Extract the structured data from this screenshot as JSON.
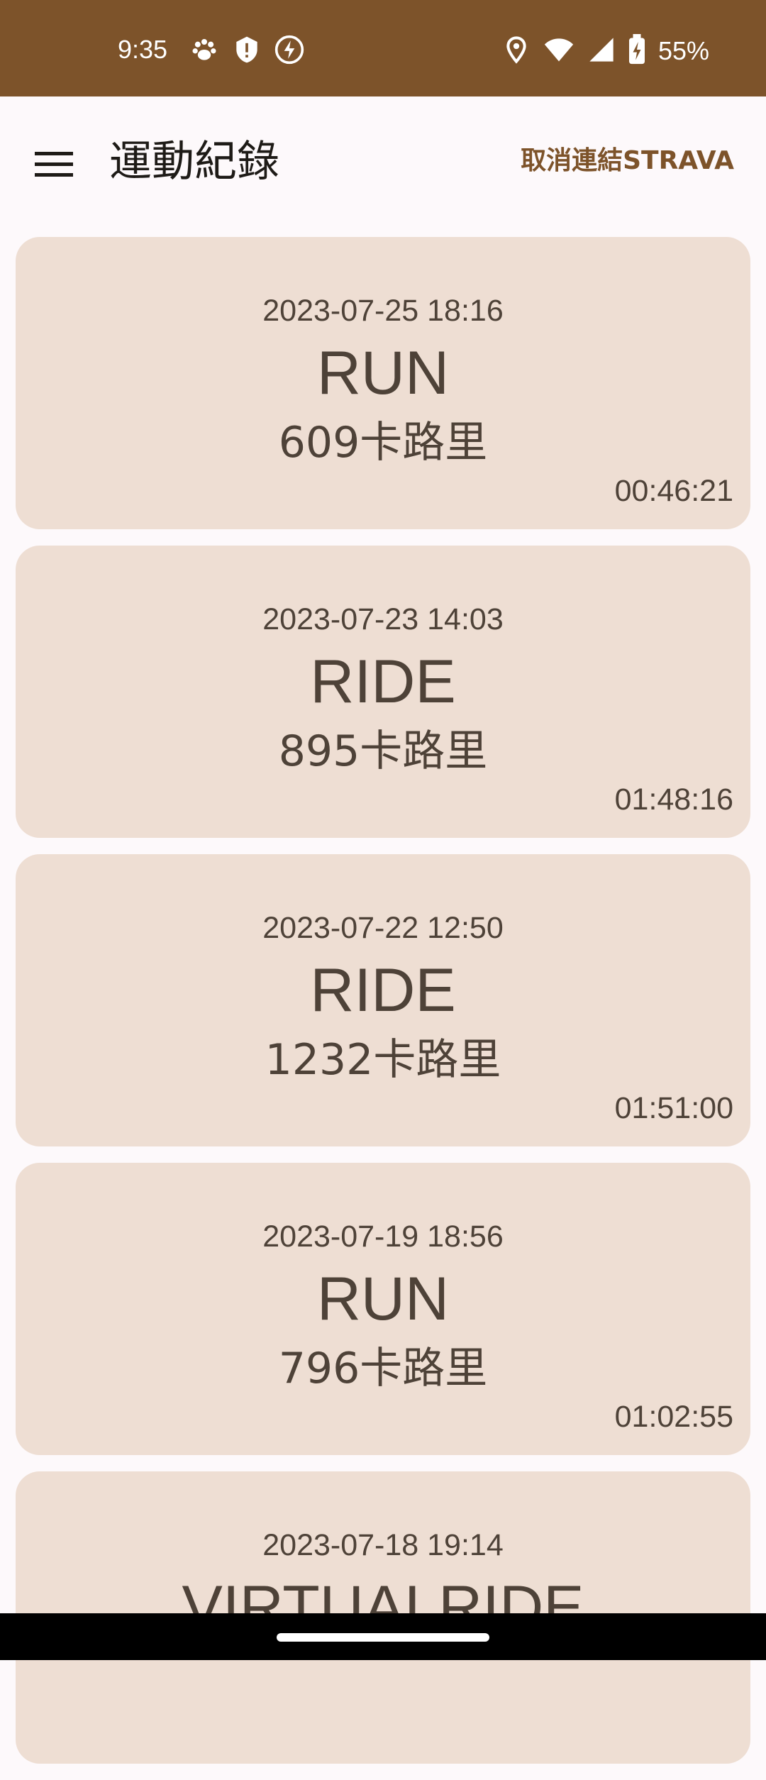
{
  "status_bar": {
    "time": "9:35",
    "left_icons": [
      "paw-icon",
      "shield-icon",
      "bolt-icon"
    ],
    "right_icons": [
      "location-icon",
      "wifi-icon",
      "signal-icon",
      "battery-charging-icon"
    ],
    "battery": "55%"
  },
  "app_bar": {
    "title": "運動紀錄",
    "menu_icon": "menu-icon",
    "unlink_label": "取消連結STRAVA"
  },
  "activities": [
    {
      "date": "2023-07-25 18:16",
      "type": "RUN",
      "calories": "609卡路里",
      "duration": "00:46:21"
    },
    {
      "date": "2023-07-23 14:03",
      "type": "RIDE",
      "calories": "895卡路里",
      "duration": "01:48:16"
    },
    {
      "date": "2023-07-22 12:50",
      "type": "RIDE",
      "calories": "1232卡路里",
      "duration": "01:51:00"
    },
    {
      "date": "2023-07-19 18:56",
      "type": "RUN",
      "calories": "796卡路里",
      "duration": "01:02:55"
    },
    {
      "date": "2023-07-18 19:14",
      "type": "VIRTUALRIDE",
      "calories": "",
      "duration": ""
    }
  ],
  "colors": {
    "status_bar": "#7d532a",
    "accent": "#7d532a",
    "card_bg": "#eeded3",
    "card_text": "#4e4238",
    "page_bg": "#fdf9fb"
  }
}
